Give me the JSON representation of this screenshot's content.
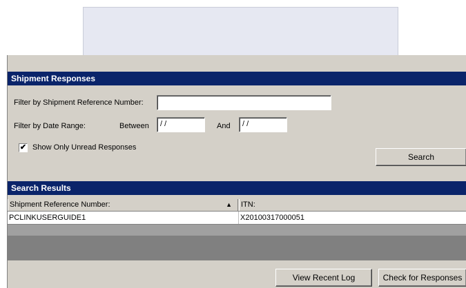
{
  "responses": {
    "title": "Shipment Responses",
    "filter_ref_label": "Filter by Shipment Reference Number:",
    "filter_ref_value": "",
    "date_label": "Filter by Date Range:",
    "between_label": "Between",
    "between_value": "/ /",
    "and_label": "And",
    "and_value": "/ /",
    "unread_label": "Show Only Unread Responses",
    "unread_checked": "✔",
    "search_button": "Search"
  },
  "results": {
    "title": "Search Results",
    "columns": [
      "Shipment Reference Number:",
      "ITN:"
    ],
    "sort_indicator": "▲",
    "rows": [
      {
        "ref": "PCLINKUSERGUIDE1",
        "itn": "X20100317000051"
      }
    ]
  },
  "footer": {
    "view_log_button": "View Recent Log",
    "check_button": "Check for Responses"
  }
}
